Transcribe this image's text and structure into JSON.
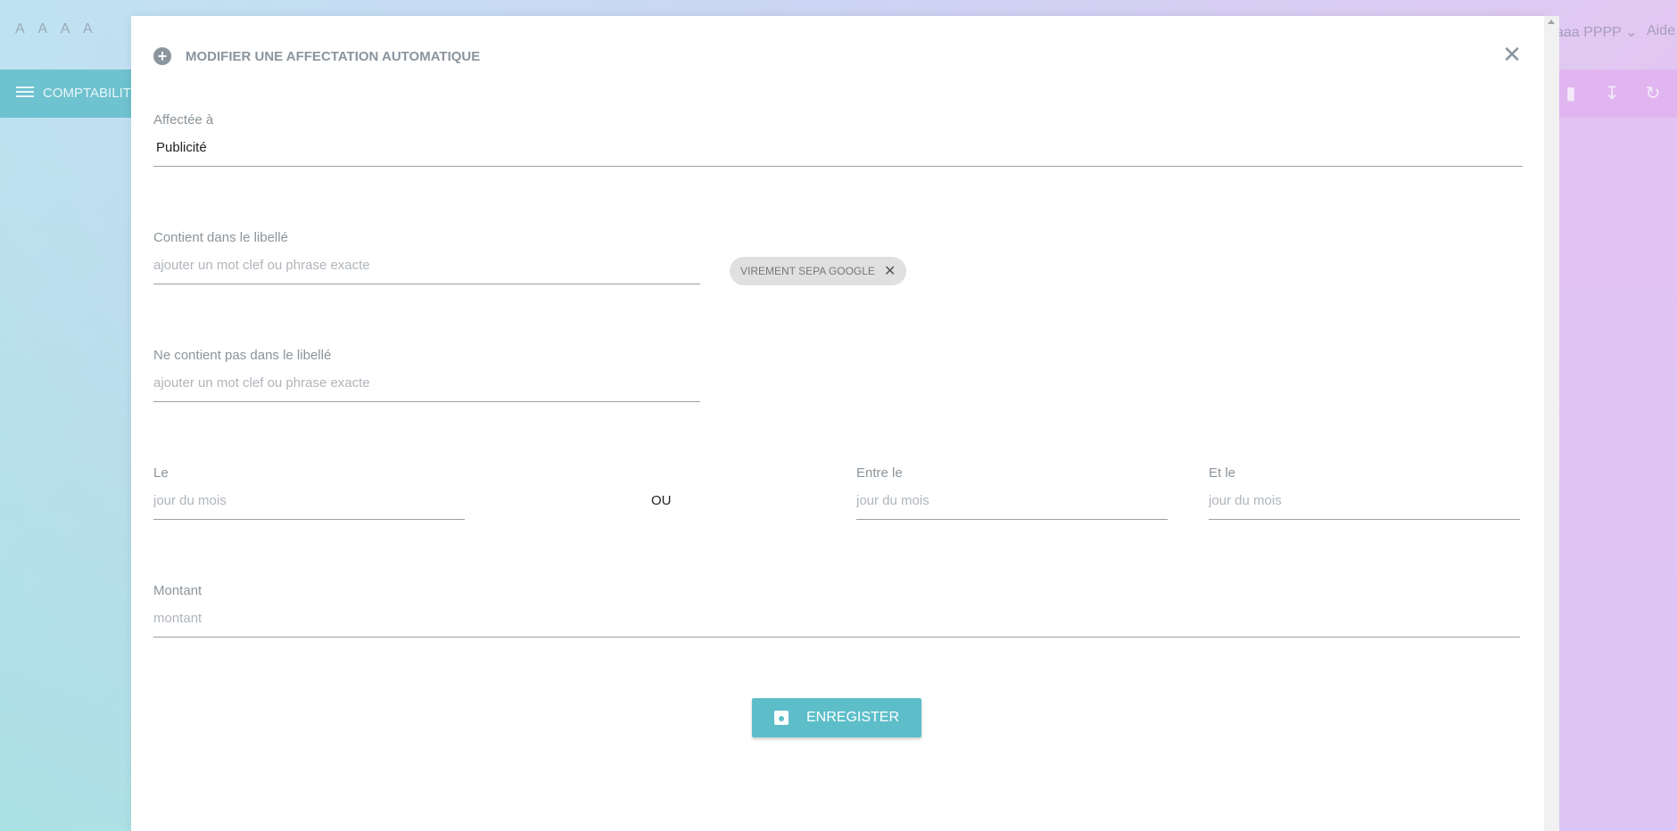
{
  "app": {
    "brand": "A A A A",
    "user_menu": "aaa PPPP",
    "help_link": "Aide",
    "section_title": "COMPTABILITE"
  },
  "toolbar": {
    "icons": [
      "tag-icon",
      "download-icon",
      "refresh-icon"
    ]
  },
  "modal": {
    "title": "MODIFIER UNE AFFECTATION AUTOMATIQUE",
    "fields": {
      "assigned_to": {
        "label": "Affectée à",
        "value": "Publicité"
      },
      "contains": {
        "label": "Contient dans le libellé",
        "placeholder": "ajouter un mot clef ou phrase exacte"
      },
      "not_contains": {
        "label": "Ne contient pas dans le libellé",
        "placeholder": "ajouter un mot clef ou phrase exacte"
      },
      "day": {
        "label": "Le",
        "placeholder": "jour du mois"
      },
      "between": {
        "label": "Entre le",
        "placeholder": "jour du mois"
      },
      "and": {
        "label": "Et le",
        "placeholder": "jour du mois"
      },
      "amount": {
        "label": "Montant",
        "placeholder": "montant"
      }
    },
    "or_text": "OU",
    "chips": [
      {
        "label": "VIREMENT SEPA GOOGLE"
      }
    ],
    "save_label": "ENREGISTER"
  },
  "colors": {
    "accent": "#5dbec9",
    "appbar": "#6fc2cf"
  }
}
